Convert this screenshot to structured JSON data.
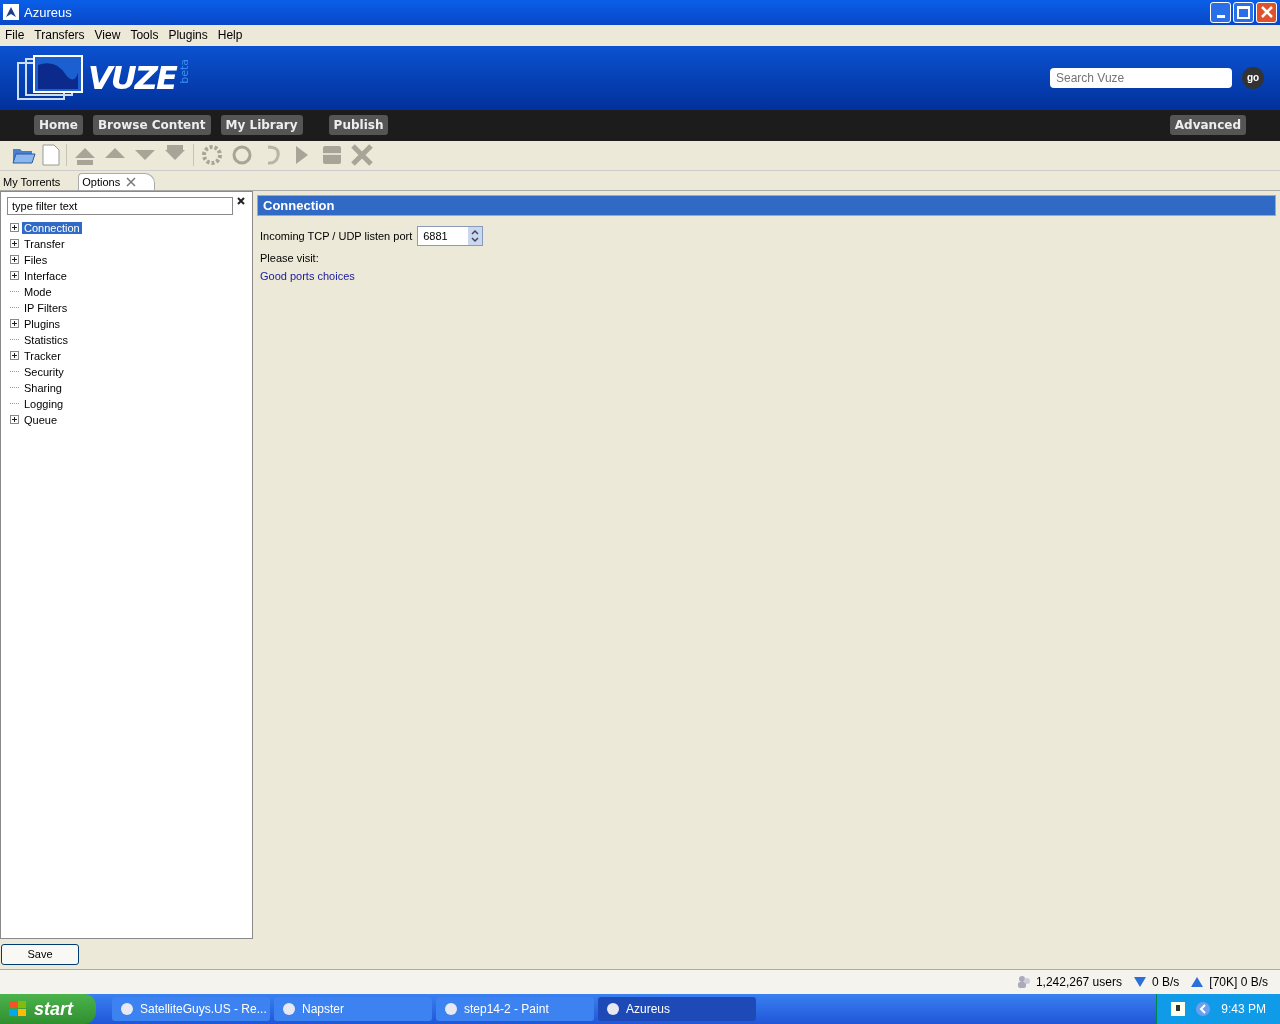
{
  "window": {
    "title": "Azureus"
  },
  "menu": [
    "File",
    "Transfers",
    "View",
    "Tools",
    "Plugins",
    "Help"
  ],
  "banner": {
    "logo": "VUZE",
    "logo_tag": "beta",
    "search": {
      "placeholder": "Search Vuze"
    },
    "go": "go"
  },
  "nav": {
    "items": [
      "Home",
      "Browse Content",
      "My Library",
      "Publish"
    ],
    "advanced": "Advanced"
  },
  "tabs": [
    {
      "label": "My Torrents",
      "selected": false,
      "closable": false
    },
    {
      "label": "Options",
      "selected": true,
      "closable": true
    }
  ],
  "filter": {
    "placeholder": "type filter text"
  },
  "tree": [
    {
      "label": "Connection",
      "kind": "branch",
      "selected": true
    },
    {
      "label": "Transfer",
      "kind": "branch",
      "selected": false
    },
    {
      "label": "Files",
      "kind": "branch",
      "selected": false
    },
    {
      "label": "Interface",
      "kind": "branch",
      "selected": false
    },
    {
      "label": "Mode",
      "kind": "leaf",
      "selected": false
    },
    {
      "label": "IP Filters",
      "kind": "leaf",
      "selected": false
    },
    {
      "label": "Plugins",
      "kind": "branch",
      "selected": false
    },
    {
      "label": "Statistics",
      "kind": "leaf",
      "selected": false
    },
    {
      "label": "Tracker",
      "kind": "branch",
      "selected": false
    },
    {
      "label": "Security",
      "kind": "leaf",
      "selected": false
    },
    {
      "label": "Sharing",
      "kind": "leaf",
      "selected": false
    },
    {
      "label": "Logging",
      "kind": "leaf",
      "selected": false
    },
    {
      "label": "Queue",
      "kind": "branch",
      "selected": false
    }
  ],
  "panel": {
    "title": "Connection",
    "port_label": "Incoming TCP / UDP listen port",
    "port": "6881",
    "visit": "Please visit:",
    "link": "Good ports choices"
  },
  "save": "Save",
  "status_bar": {
    "users": "1,242,267 users",
    "down": "0 B/s",
    "up": "[70K] 0 B/s"
  },
  "taskbar": {
    "start": "start",
    "items": [
      {
        "label": "SatelliteGuys.US - Re...",
        "selected": false
      },
      {
        "label": "Napster",
        "selected": false
      },
      {
        "label": "step14-2 - Paint",
        "selected": false
      },
      {
        "label": "Azureus",
        "selected": true
      }
    ],
    "clock": "9:43 PM"
  }
}
